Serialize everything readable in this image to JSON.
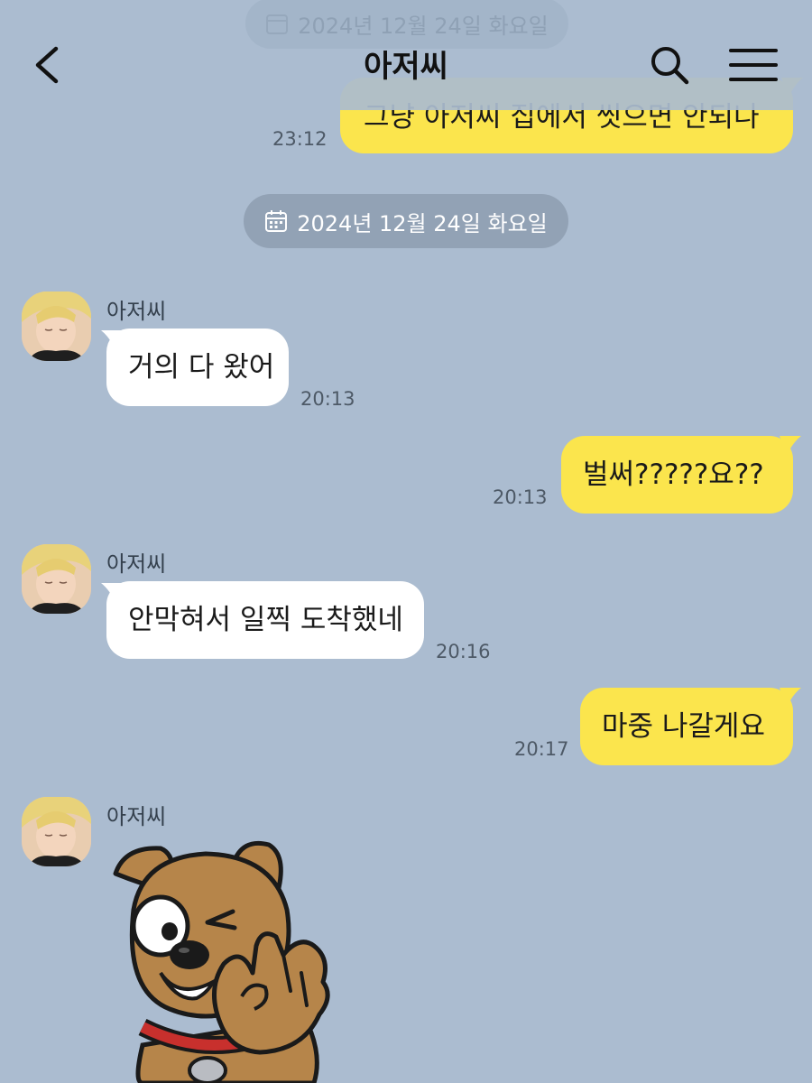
{
  "header": {
    "title": "아저씨",
    "ghost_date": "2024년 12월 24일 화요일",
    "back_icon": "chevron-left-icon",
    "search_icon": "search-icon",
    "menu_icon": "hamburger-menu-icon"
  },
  "messages": {
    "m0": {
      "text": "그냥 아저씨 집에서 씻으면 안되나",
      "time": "23:12"
    },
    "date_divider": "2024년 12월 24일 화요일",
    "m1": {
      "sender": "아저씨",
      "text": "거의 다 왔어",
      "time": "20:13"
    },
    "m2": {
      "text": "벌써?????요??",
      "time": "20:13"
    },
    "m3": {
      "sender": "아저씨",
      "text": "안막혀서 일찍 도착했네",
      "time": "20:16"
    },
    "m4": {
      "text": "마중 나갈게요",
      "time": "20:17"
    },
    "m5": {
      "sender": "아저씨"
    }
  },
  "colors": {
    "background": "#abbcd0",
    "my_bubble": "#fbe54d",
    "other_bubble": "#ffffff",
    "date_pill": "#7d8c9e"
  }
}
